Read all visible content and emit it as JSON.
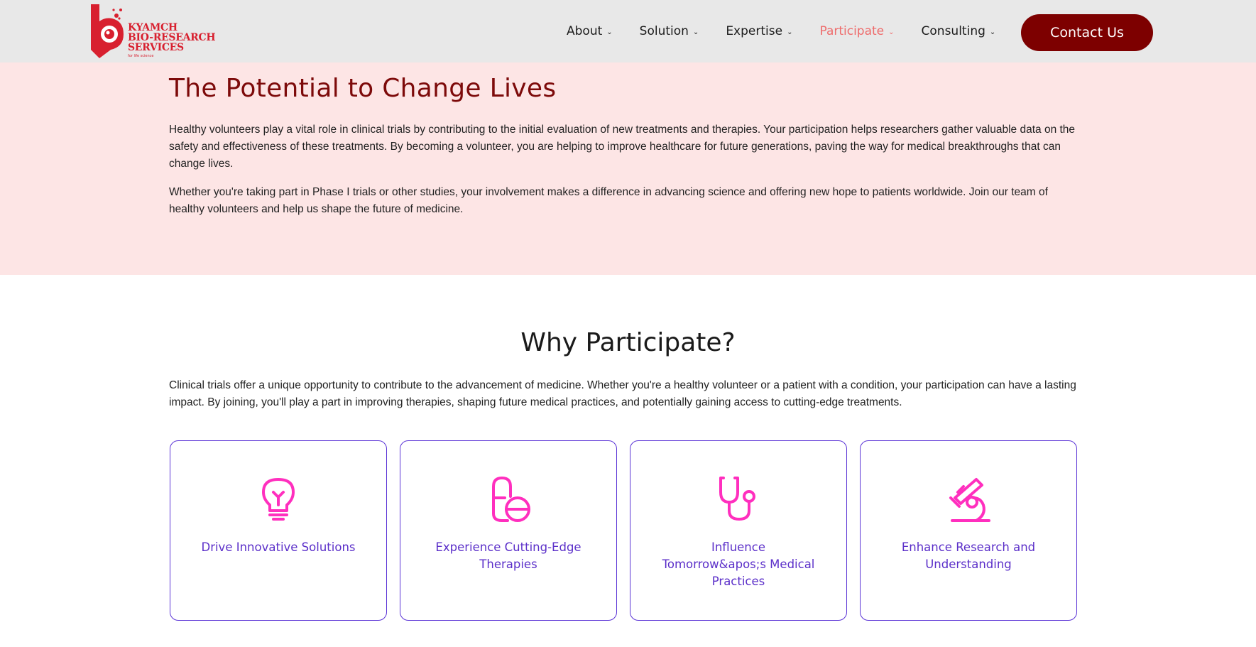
{
  "logo": {
    "lines": [
      "KYAMCH",
      "BIO-RESEARCH",
      "SERVICES"
    ],
    "tagline": "for life science"
  },
  "nav": {
    "items": [
      {
        "label": "About"
      },
      {
        "label": "Solution"
      },
      {
        "label": "Expertise"
      },
      {
        "label": "Participate",
        "active": true
      },
      {
        "label": "Consulting"
      }
    ],
    "contact_label": "Contact Us"
  },
  "hero": {
    "title": "The Potential to Change Lives",
    "paragraphs": [
      "Healthy volunteers play a vital role in clinical trials by contributing to the initial evaluation of new treatments and therapies. Your participation helps researchers gather valuable data on the safety and effectiveness of these treatments. By becoming a volunteer, you are helping to improve healthcare for future generations, paving the way for medical breakthroughs that can change lives.",
      "Whether you're taking part in Phase I trials or other studies, your involvement makes a difference in advancing science and offering new hope to patients worldwide. Join our team of healthy volunteers and help us shape the future of medicine."
    ]
  },
  "why": {
    "title": "Why Participate?",
    "paragraph": "Clinical trials offer a unique opportunity to contribute to the advancement of medicine. Whether you're a healthy volunteer or a patient with a condition, your participation can have a lasting impact. By joining, you'll play a part in improving therapies, shaping future medical practices, and potentially gaining access to cutting-edge treatments.",
    "cards": [
      {
        "label": "Drive Innovative Solutions",
        "icon": "lightbulb-icon"
      },
      {
        "label": "Experience Cutting-Edge Therapies",
        "icon": "pill-icon"
      },
      {
        "label": "Influence Tomorrow&apos;s Medical Practices",
        "icon": "stethoscope-icon"
      },
      {
        "label": "Enhance Research and Understanding",
        "icon": "microscope-icon"
      }
    ]
  },
  "colors": {
    "brand_red": "#d8202f",
    "dark_red": "#7d0000",
    "nav_active": "#ee6b6b",
    "hero_bg": "#fde5e5",
    "card_border": "#5b34d6",
    "card_text": "#5b2fc9",
    "icon_pink": "#ff2fbe"
  }
}
